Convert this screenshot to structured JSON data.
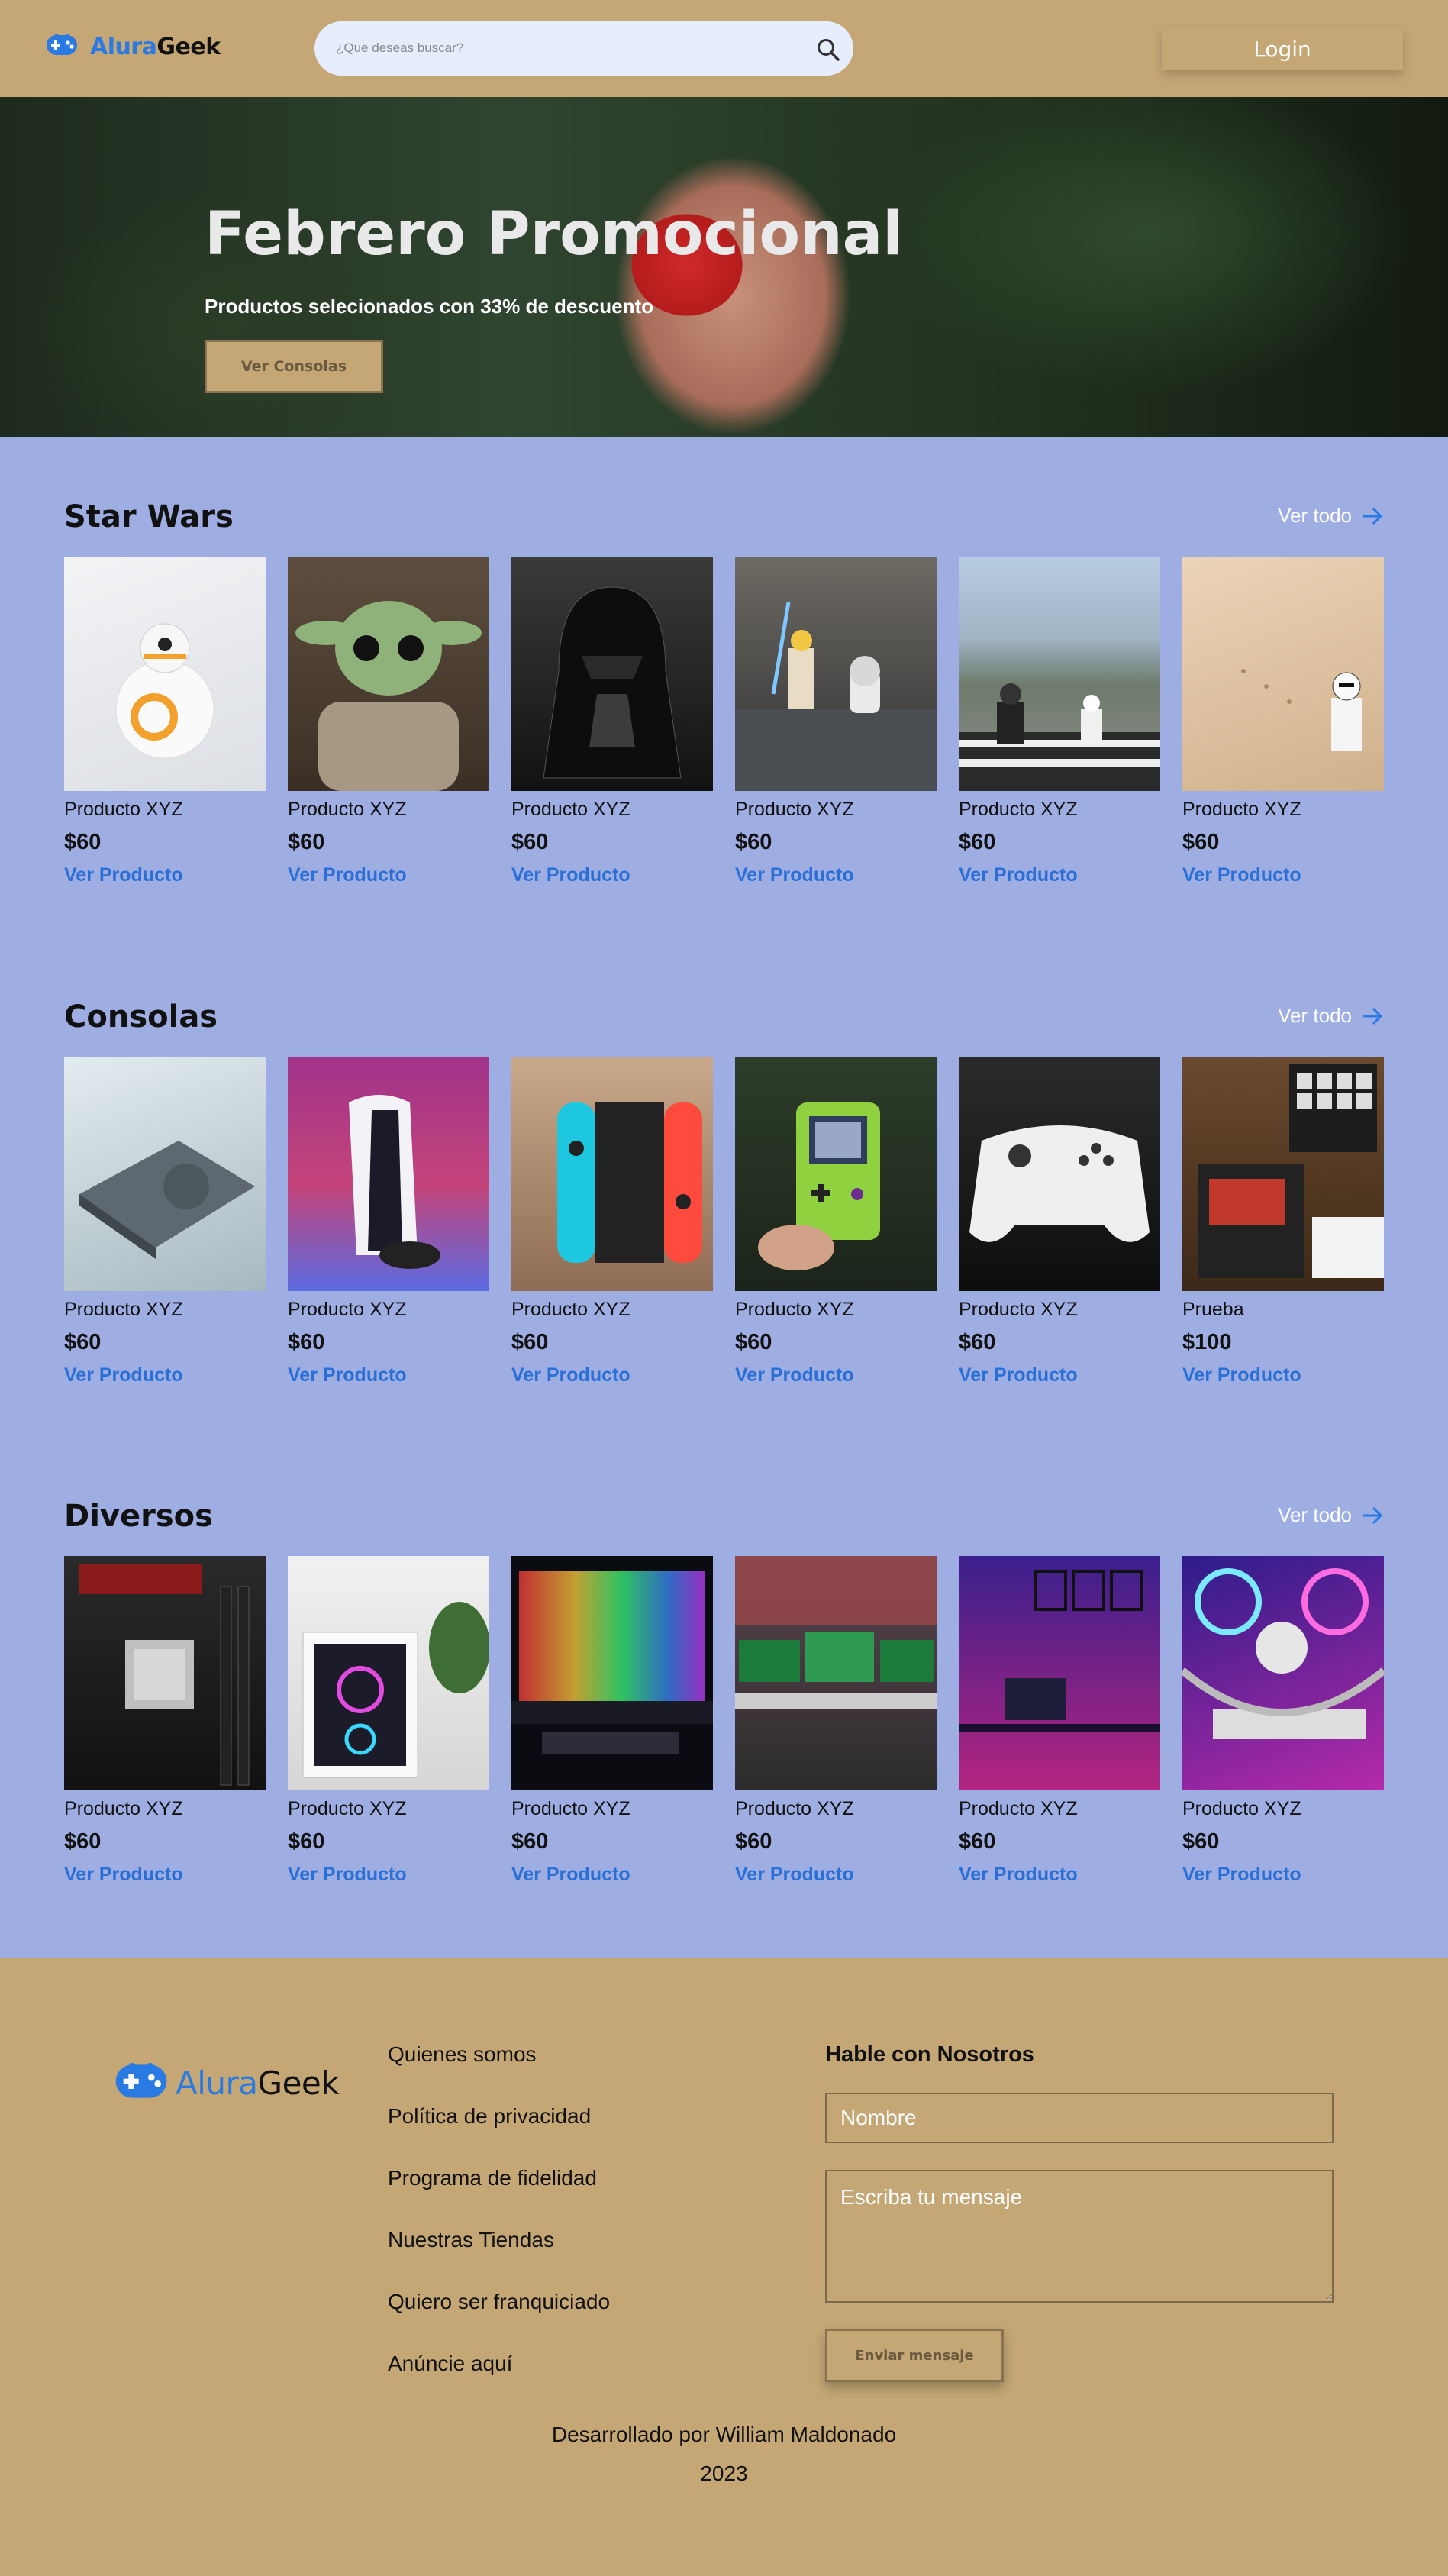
{
  "brand": {
    "alura": "Alura",
    "geek": "Geek",
    "accent": "#2a7ae4",
    "header_bg": "#c4a775",
    "page_bg": "#9eaee2"
  },
  "header": {
    "search_placeholder": "¿Que deseas buscar?",
    "login_label": "Login"
  },
  "hero": {
    "title": "Febrero Promocional",
    "subtitle": "Productos selecionados con 33% de descuento",
    "button_label": "Ver Consolas"
  },
  "sections": [
    {
      "title": "Star Wars",
      "see_all": "Ver todo",
      "products": [
        {
          "name": "Producto XYZ",
          "price": "$60",
          "link": "Ver Producto",
          "image": "bb8-droid-toy"
        },
        {
          "name": "Producto XYZ",
          "price": "$60",
          "link": "Ver Producto",
          "image": "baby-yoda-figure"
        },
        {
          "name": "Producto XYZ",
          "price": "$60",
          "link": "Ver Producto",
          "image": "darth-vader-helmet"
        },
        {
          "name": "Producto XYZ",
          "price": "$60",
          "link": "Ver Producto",
          "image": "lego-luke-r2d2"
        },
        {
          "name": "Producto XYZ",
          "price": "$60",
          "link": "Ver Producto",
          "image": "lego-stormtroopers-street"
        },
        {
          "name": "Producto XYZ",
          "price": "$60",
          "link": "Ver Producto",
          "image": "lego-stormtrooper-sand"
        }
      ]
    },
    {
      "title": "Consolas",
      "see_all": "Ver todo",
      "products": [
        {
          "name": "Producto XYZ",
          "price": "$60",
          "link": "Ver Producto",
          "image": "playstation-1"
        },
        {
          "name": "Producto XYZ",
          "price": "$60",
          "link": "Ver Producto",
          "image": "playstation-5"
        },
        {
          "name": "Producto XYZ",
          "price": "$60",
          "link": "Ver Producto",
          "image": "nintendo-switch"
        },
        {
          "name": "Producto XYZ",
          "price": "$60",
          "link": "Ver Producto",
          "image": "gameboy-color"
        },
        {
          "name": "Producto XYZ",
          "price": "$60",
          "link": "Ver Producto",
          "image": "xbox-controller"
        },
        {
          "name": "Prueba",
          "price": "$100",
          "link": "Ver Producto",
          "image": "music-controller"
        }
      ]
    },
    {
      "title": "Diversos",
      "see_all": "Ver todo",
      "products": [
        {
          "name": "Producto XYZ",
          "price": "$60",
          "link": "Ver Producto",
          "image": "motherboard-cpu"
        },
        {
          "name": "Producto XYZ",
          "price": "$60",
          "link": "Ver Producto",
          "image": "white-pc-case"
        },
        {
          "name": "Producto XYZ",
          "price": "$60",
          "link": "Ver Producto",
          "image": "rgb-gaming-desk"
        },
        {
          "name": "Producto XYZ",
          "price": "$60",
          "link": "Ver Producto",
          "image": "multi-monitor-setup"
        },
        {
          "name": "Producto XYZ",
          "price": "$60",
          "link": "Ver Producto",
          "image": "neon-room"
        },
        {
          "name": "Producto XYZ",
          "price": "$60",
          "link": "Ver Producto",
          "image": "rgb-pc-internals"
        }
      ]
    }
  ],
  "footer": {
    "links": [
      "Quienes somos",
      "Política de privacidad",
      "Programa de fidelidad",
      "Nuestras Tiendas",
      "Quiero ser franquiciado",
      "Anúncie aquí"
    ],
    "contact_title": "Hable con Nosotros",
    "name_placeholder": "Nombre",
    "message_placeholder": "Escriba tu mensaje",
    "send_label": "Enviar mensaje",
    "credit": "Desarrollado por William Maldonado",
    "year": "2023"
  }
}
